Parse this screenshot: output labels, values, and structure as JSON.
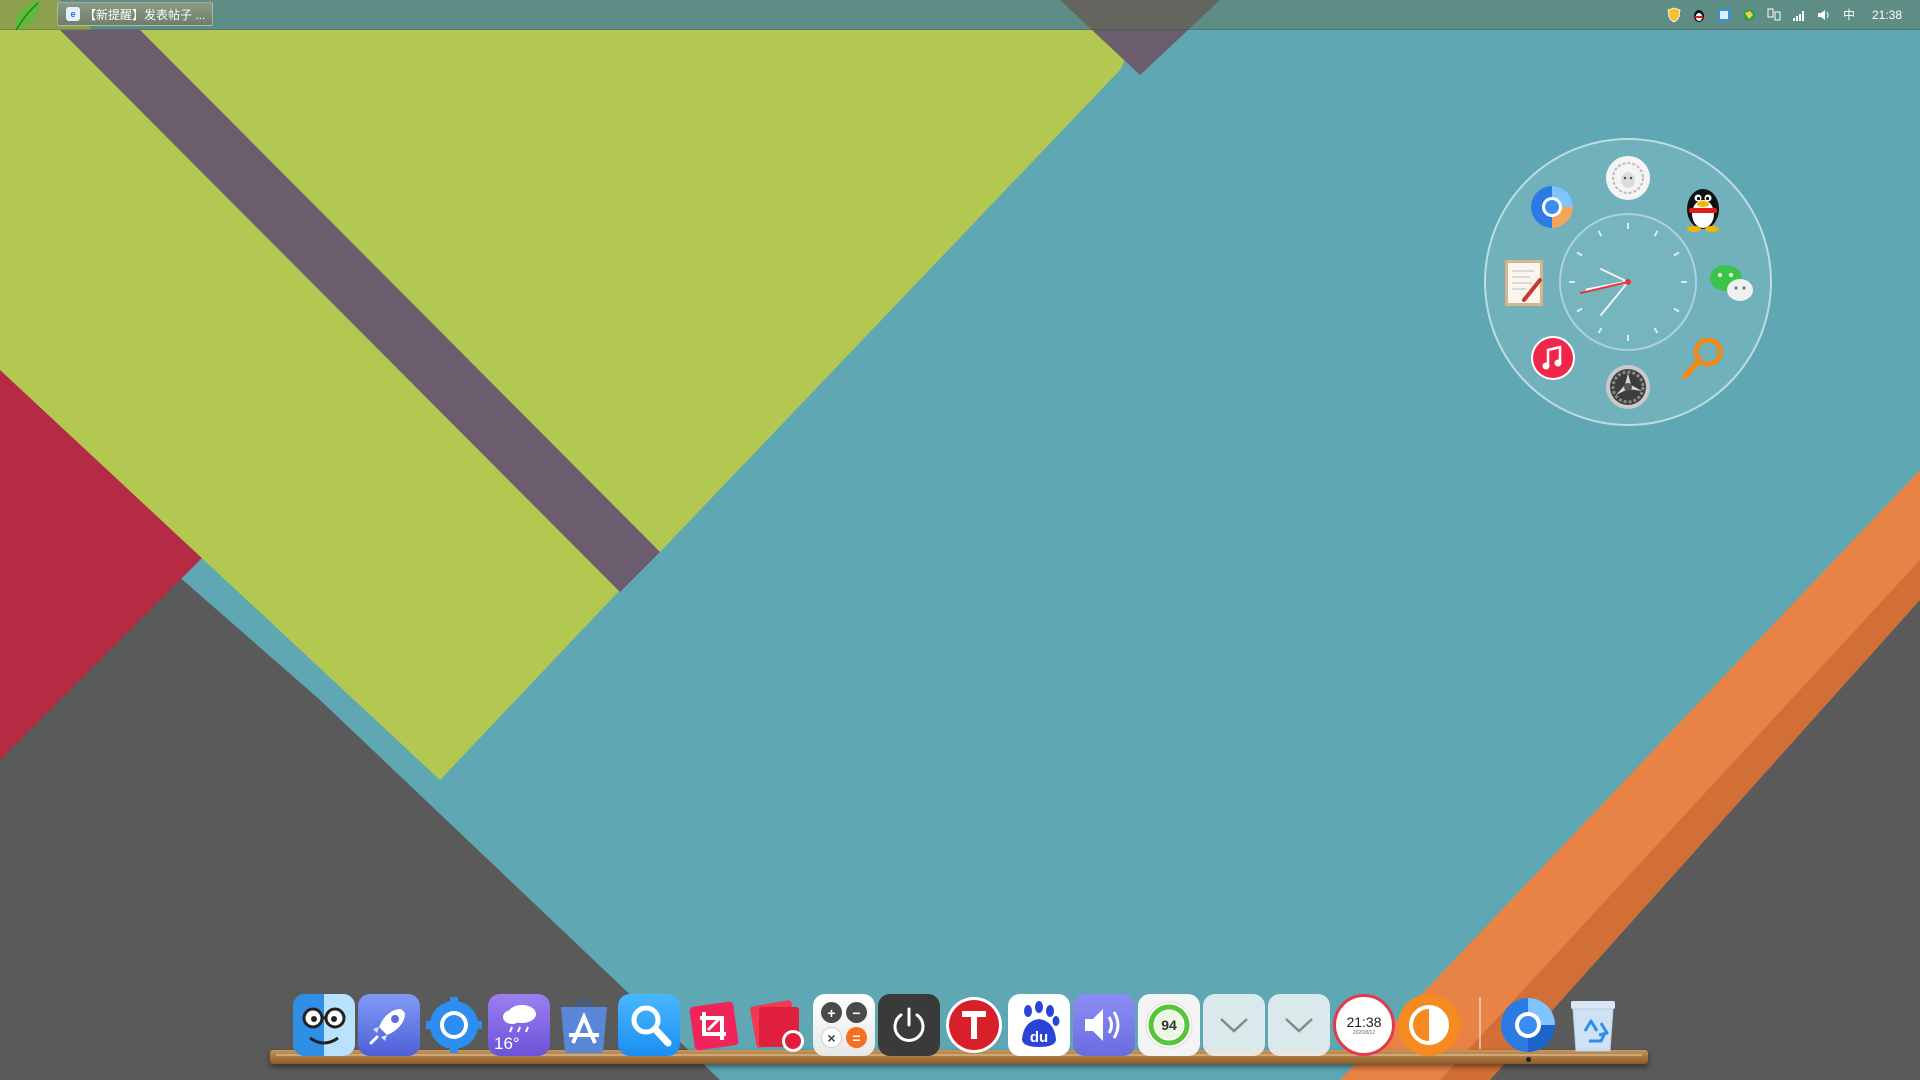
{
  "taskbar": {
    "window_title": "【新提醒】发表帖子 ...",
    "window_icon": "browser-icon",
    "tray_icons": [
      "shield-icon",
      "qq-penguin-icon",
      "notes-icon",
      "network-globe-icon",
      "network-connection-icon",
      "signal-bars-icon",
      "volume-icon"
    ],
    "input_method": "中",
    "time": "21:38"
  },
  "ring_widget": {
    "apps": [
      {
        "name": "lion-app",
        "icon": "lion-icon"
      },
      {
        "name": "qq",
        "icon": "qq-penguin-icon"
      },
      {
        "name": "wechat",
        "icon": "wechat-icon"
      },
      {
        "name": "search",
        "icon": "magnifier-icon"
      },
      {
        "name": "system-preferences",
        "icon": "gear-icon"
      },
      {
        "name": "music",
        "icon": "music-icon"
      },
      {
        "name": "text-editor",
        "icon": "notepad-icon"
      },
      {
        "name": "chrome",
        "icon": "chrome-icon"
      }
    ],
    "clock": {
      "hour": 21,
      "minute": 38
    }
  },
  "dock": {
    "items": [
      {
        "name": "finder",
        "icon": "finder-face-icon"
      },
      {
        "name": "launchpad",
        "icon": "rocket-icon"
      },
      {
        "name": "settings",
        "icon": "blue-gear-icon"
      },
      {
        "name": "weather",
        "icon": "rain-cloud-icon",
        "temperature": "16°"
      },
      {
        "name": "app-store",
        "icon": "app-store-icon"
      },
      {
        "name": "search",
        "icon": "magnifier-icon"
      },
      {
        "name": "screenshot-crop",
        "icon": "crop-icon"
      },
      {
        "name": "screen-recorder",
        "icon": "record-icon"
      },
      {
        "name": "calculator",
        "icon": "calculator-icon"
      },
      {
        "name": "power",
        "icon": "power-icon"
      },
      {
        "name": "typora",
        "icon": "t-icon"
      },
      {
        "name": "baidu",
        "icon": "baidu-paw-icon",
        "text": "du"
      },
      {
        "name": "volume",
        "icon": "speaker-icon"
      },
      {
        "name": "battery",
        "icon": "battery-ring-icon",
        "value": "94"
      },
      {
        "name": "drawer-1",
        "icon": "chevron-down-icon"
      },
      {
        "name": "drawer-2",
        "icon": "chevron-down-icon"
      },
      {
        "name": "clock",
        "icon": "clock-icon",
        "time": "21:38",
        "date": "2020/8/12"
      },
      {
        "name": "brightness",
        "icon": "half-circle-icon"
      },
      {
        "name": "chrome",
        "icon": "chrome-icon"
      },
      {
        "name": "recycle-bin",
        "icon": "recycle-bin-icon"
      }
    ]
  },
  "colors": {
    "teal": "#5ea7b3",
    "lime": "#b3c850",
    "purple": "#6e5f72",
    "red": "#b52a44",
    "gray": "#5b5b5b",
    "orange": "#e98345"
  }
}
